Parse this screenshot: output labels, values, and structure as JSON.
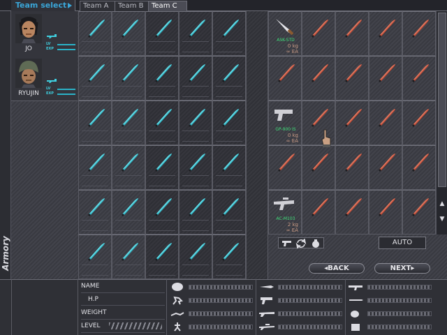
{
  "tabs": {
    "team_select": "Team select",
    "items": [
      "Team A",
      "Team B",
      "Team C"
    ],
    "active": "Team C"
  },
  "sidebar": {
    "label": "Armory"
  },
  "members": [
    {
      "name": "JO",
      "lv_label": "LV",
      "exp_label": "EXP",
      "icon": "face-portrait-icon"
    },
    {
      "name": "RYUJIN",
      "lv_label": "LV",
      "exp_label": "EXP",
      "icon": "helmet-portrait-icon"
    }
  ],
  "weapons": [
    {
      "name": "ASK-STD",
      "weight": "0 kg",
      "ammo": "∞ EA",
      "icon": "knife-icon"
    },
    {
      "name": "GP-900 IS",
      "weight": "0 kg",
      "ammo": "∞ EA",
      "icon": "pistol-icon"
    },
    {
      "name": "AC-M103",
      "weight": "2 kg",
      "ammo": "∞ EA",
      "icon": "rifle-icon"
    }
  ],
  "buttons": {
    "auto": "AUTO",
    "back": "BACK",
    "next": "NEXT"
  },
  "info_labels": {
    "name": "NAME",
    "hp": "H.P",
    "weight": "WEIGHT",
    "level": "LEVEL"
  },
  "colors": {
    "team_bullet": "#2fb8c8",
    "armory_bullet": "#c24a35",
    "accent": "#3aa6d8",
    "weapon_label": "#3fe07a"
  }
}
